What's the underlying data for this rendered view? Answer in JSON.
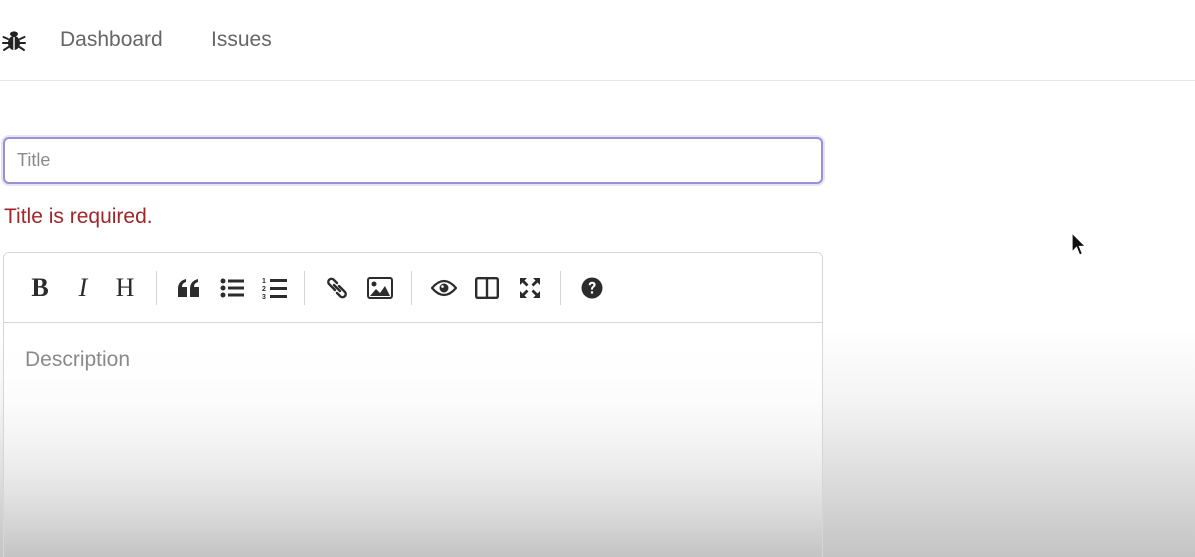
{
  "nav": {
    "logo_icon": "bug-icon",
    "links": [
      "Dashboard",
      "Issues"
    ]
  },
  "form": {
    "title_placeholder": "Title",
    "title_value": "",
    "title_error": "Title is required.",
    "description_placeholder": "Description"
  },
  "toolbar": {
    "buttons": [
      {
        "name": "bold",
        "glyph": "B"
      },
      {
        "name": "italic",
        "glyph": "I"
      },
      {
        "name": "heading",
        "glyph": "H"
      },
      {
        "name": "quote",
        "icon": "quote-icon"
      },
      {
        "name": "unordered-list",
        "icon": "bullet-list-icon"
      },
      {
        "name": "ordered-list",
        "icon": "numbered-list-icon"
      },
      {
        "name": "link",
        "icon": "link-icon"
      },
      {
        "name": "image",
        "icon": "image-icon"
      },
      {
        "name": "preview",
        "icon": "eye-icon"
      },
      {
        "name": "side-by-side",
        "icon": "columns-icon"
      },
      {
        "name": "fullscreen",
        "icon": "fullscreen-icon"
      },
      {
        "name": "guide",
        "icon": "question-circle-icon"
      }
    ]
  },
  "colors": {
    "focus_border": "#9b8fd8",
    "error_text": "#a0262b",
    "nav_text": "#666666"
  }
}
